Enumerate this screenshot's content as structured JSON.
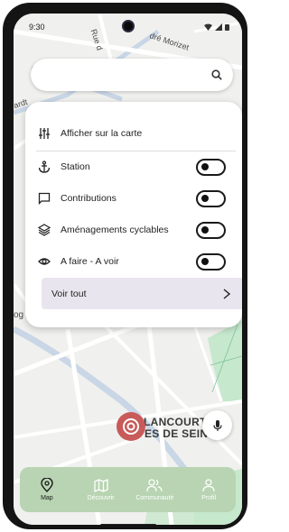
{
  "status_bar": {
    "time": "9:30"
  },
  "search": {
    "placeholder": "",
    "icon": "search-icon"
  },
  "map": {
    "street_top": "dré Morizet",
    "street_rue": "Rue d",
    "street_left": "ardt",
    "street_og": "og",
    "place_name_line1": "LANCOURT",
    "place_name_line2": "ES DE SEIN"
  },
  "layers_menu": {
    "header": "Afficher sur la carte",
    "items": [
      {
        "label": "Station",
        "icon": "anchor-icon",
        "enabled": false
      },
      {
        "label": "Contributions",
        "icon": "comment-icon",
        "enabled": false
      },
      {
        "label": "Aménagements cyclables",
        "icon": "layers-icon",
        "enabled": false
      },
      {
        "label": "A faire - A voir",
        "icon": "eye-icon",
        "enabled": false
      }
    ],
    "see_all": {
      "label": "Voir tout",
      "arrow": ">"
    }
  },
  "nav": {
    "items": [
      {
        "label": "Map",
        "icon": "map-pin-icon",
        "active": true
      },
      {
        "label": "Découvrir",
        "icon": "map-icon",
        "active": false
      },
      {
        "label": "Communauté",
        "icon": "users-icon",
        "active": false
      },
      {
        "label": "Profil",
        "icon": "user-icon",
        "active": false
      }
    ]
  },
  "colors": {
    "nav_bg": "#b8d4b2",
    "marker": "#c95a5a",
    "see_all_bg": "#e9e5ee",
    "park_green": "#c6e8cc"
  }
}
